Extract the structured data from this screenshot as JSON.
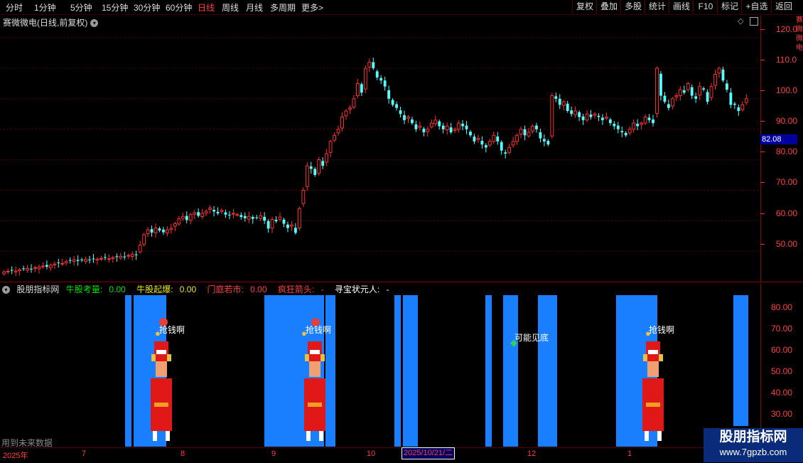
{
  "toolbar": {
    "periods": [
      "分时",
      "1分钟",
      "5分钟",
      "15分钟",
      "30分钟",
      "60分钟",
      "日线",
      "周线",
      "月线",
      "多周期",
      "更多"
    ],
    "active_period": "日线",
    "more_chevron": ">",
    "buttons": [
      "复权",
      "叠加",
      "多股",
      "统计",
      "画线",
      "F10",
      "标记",
      "+自选",
      "返回"
    ]
  },
  "stock": {
    "title": "赛微微电(日线,前复权)",
    "toggle_icon": "chevron-down-icon"
  },
  "price_axis": {
    "labels": [
      "120.0",
      "110.0",
      "100.0",
      "90.00",
      "80.00",
      "70.00",
      "60.00",
      "50.00"
    ],
    "current_price": "82.08"
  },
  "chart_data": {
    "type": "candlestick",
    "title": "赛微微电(日线,前复权)",
    "ylim": [
      40,
      124
    ],
    "x_labels": [
      "2025年",
      "7",
      "8",
      "9",
      "10",
      "2025/10/21/二",
      "12",
      "1"
    ],
    "closes": [
      43.2,
      43.4,
      43.6,
      43.5,
      43.9,
      44.1,
      44.3,
      44.0,
      44.6,
      44.8,
      45.1,
      44.9,
      45.4,
      45.8,
      46.2,
      46.0,
      46.6,
      47.0,
      47.2,
      46.8,
      47.0,
      47.3,
      47.1,
      47.5,
      47.4,
      47.6,
      47.8,
      47.5,
      47.9,
      48.1,
      48.3,
      48.0,
      48.6,
      49.0,
      48.7,
      52.0,
      55.4,
      57.0,
      56.1,
      57.6,
      56.8,
      56.2,
      57.0,
      57.5,
      59.0,
      60.6,
      61.4,
      60.2,
      62.0,
      62.6,
      61.6,
      62.4,
      63.1,
      64.2,
      63.0,
      62.4,
      63.4,
      62.0,
      61.8,
      62.4,
      62.0,
      61.2,
      60.8,
      61.4,
      60.6,
      61.0,
      61.6,
      60.0,
      57.4,
      60.4,
      59.8,
      61.2,
      59.0,
      57.6,
      58.6,
      56.0,
      64.0,
      70.0,
      78.0,
      77.0,
      75.0,
      80.0,
      78.0,
      82.0,
      86.0,
      88.0,
      90.0,
      94.0,
      96.0,
      97.0,
      100.0,
      105.0,
      102.0,
      110.0,
      112.0,
      110.0,
      107.0,
      106.0,
      104.0,
      100.0,
      98.0,
      97.0,
      95.0,
      93.0,
      94.0,
      92.0,
      90.0,
      91.0,
      89.0,
      90.0,
      92.0,
      93.0,
      91.0,
      90.0,
      91.0,
      89.0,
      90.0,
      92.0,
      91.0,
      90.0,
      88.0,
      86.0,
      87.0,
      85.0,
      84.0,
      86.0,
      88.0,
      86.0,
      83.0,
      82.0,
      84.0,
      86.0,
      88.0,
      90.0,
      88.0,
      89.0,
      91.0,
      90.0,
      87.0,
      86.0,
      85.0,
      101.0,
      100.0,
      98.0,
      99.0,
      96.0,
      95.0,
      96.0,
      94.0,
      93.0,
      95.0,
      94.0,
      95.0,
      94.0,
      93.0,
      94.0,
      92.0,
      91.0,
      90.0,
      89.0,
      88.0,
      90.0,
      92.0,
      91.0,
      92.0,
      94.0,
      93.0,
      92.0,
      110.0,
      101.0,
      99.0,
      97.0,
      100.0,
      101.0,
      103.0,
      102.0,
      105.0,
      101.0,
      100.0,
      104.0,
      103.0,
      99.0,
      104.0,
      108.0,
      110.0,
      106.0,
      103.0,
      98.0,
      98.0,
      96.0,
      98.0,
      100.0
    ]
  },
  "indicator": {
    "name": "股朋指标网",
    "values": [
      {
        "label": "牛股考量:",
        "value": "0.00",
        "color": "#00e000"
      },
      {
        "label": "牛股起爆:",
        "value": "0.00",
        "color": "#e8e800"
      },
      {
        "label": "门庭若市:",
        "value": "0.00",
        "color": "#ff4040"
      },
      {
        "label": "疯狂箭头:",
        "value": "-",
        "color": "#ff4040"
      },
      {
        "label": "寻宝状元人:",
        "value": "-",
        "color": "#ffffff"
      }
    ],
    "axis_labels": [
      "80.00",
      "70.00",
      "60.00",
      "50.00",
      "40.00",
      "30.00"
    ],
    "markers": [
      "抢钱啊",
      "抢钱啊",
      "可能见底",
      "抢钱啊"
    ]
  },
  "footer": {
    "future_text": "用到未来数据",
    "date_labels": [
      "2025年",
      "7",
      "8",
      "9",
      "10",
      "12",
      "1"
    ],
    "highlight_date": "2025/10/21/二"
  },
  "watermark": {
    "line1": "股朋指标网",
    "line2": "www.7gpzb.com"
  },
  "side_text": "赛微微电"
}
